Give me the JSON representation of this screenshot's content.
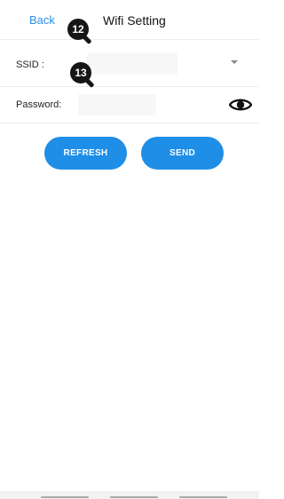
{
  "header": {
    "back_label": "Back",
    "title": "Wifi Setting"
  },
  "annotations": [
    {
      "number": "12"
    },
    {
      "number": "13"
    }
  ],
  "form": {
    "ssid_label": "SSID :",
    "ssid_value": "",
    "password_label": "Password:",
    "password_value": ""
  },
  "buttons": {
    "refresh_label": "REFRESH",
    "send_label": "SEND"
  },
  "colors": {
    "accent": "#1f8ee6",
    "link": "#2a8fe8"
  },
  "icons": {
    "dropdown": "chevron-down-icon",
    "visibility": "eye-icon"
  }
}
